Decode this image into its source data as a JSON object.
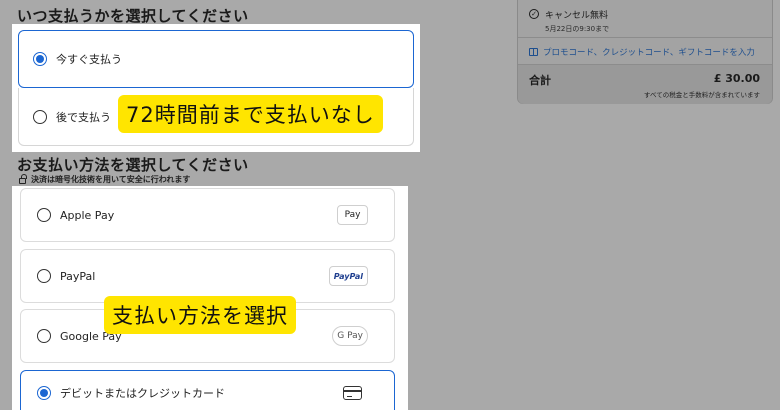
{
  "when_section": {
    "title": "いつ支払うかを選択してください",
    "options": [
      {
        "label": "今すぐ支払う",
        "selected": true
      },
      {
        "label": "後で支払う",
        "selected": false
      }
    ]
  },
  "captions": {
    "pay_later_note": "72時間前まで支払いなし",
    "choose_method_note": "支払い方法を選択"
  },
  "method_section": {
    "title": "お支払い方法を選択してください",
    "secure_note": "決済は暗号化技術を用いて安全に行われます",
    "methods": [
      {
        "label": "Apple Pay",
        "badge": " Pay",
        "icon": "apple-pay-icon",
        "selected": false
      },
      {
        "label": "PayPal",
        "badge": "PayPal",
        "icon": "paypal-icon",
        "selected": false
      },
      {
        "label": "Google Pay",
        "badge": "G Pay",
        "icon": "google-pay-icon",
        "selected": false
      },
      {
        "label": "デビットまたはクレジットカード",
        "badge": "",
        "icon": "credit-card-icon",
        "selected": true
      }
    ]
  },
  "summary": {
    "cancel_title": "キャンセル無料",
    "cancel_deadline": "5月22日の9:30まで",
    "promo_link": "プロモコード、クレジットコード、ギフトコードを入力",
    "total_label": "合計",
    "total_amount": "£ 30.00",
    "tax_note": "すべての税金と手数料が含まれています"
  },
  "colors": {
    "accent": "#1b66d2",
    "caption_bg": "#ffe500",
    "dim_overlay": "#a9a9a9",
    "link": "#1d4e8e"
  }
}
